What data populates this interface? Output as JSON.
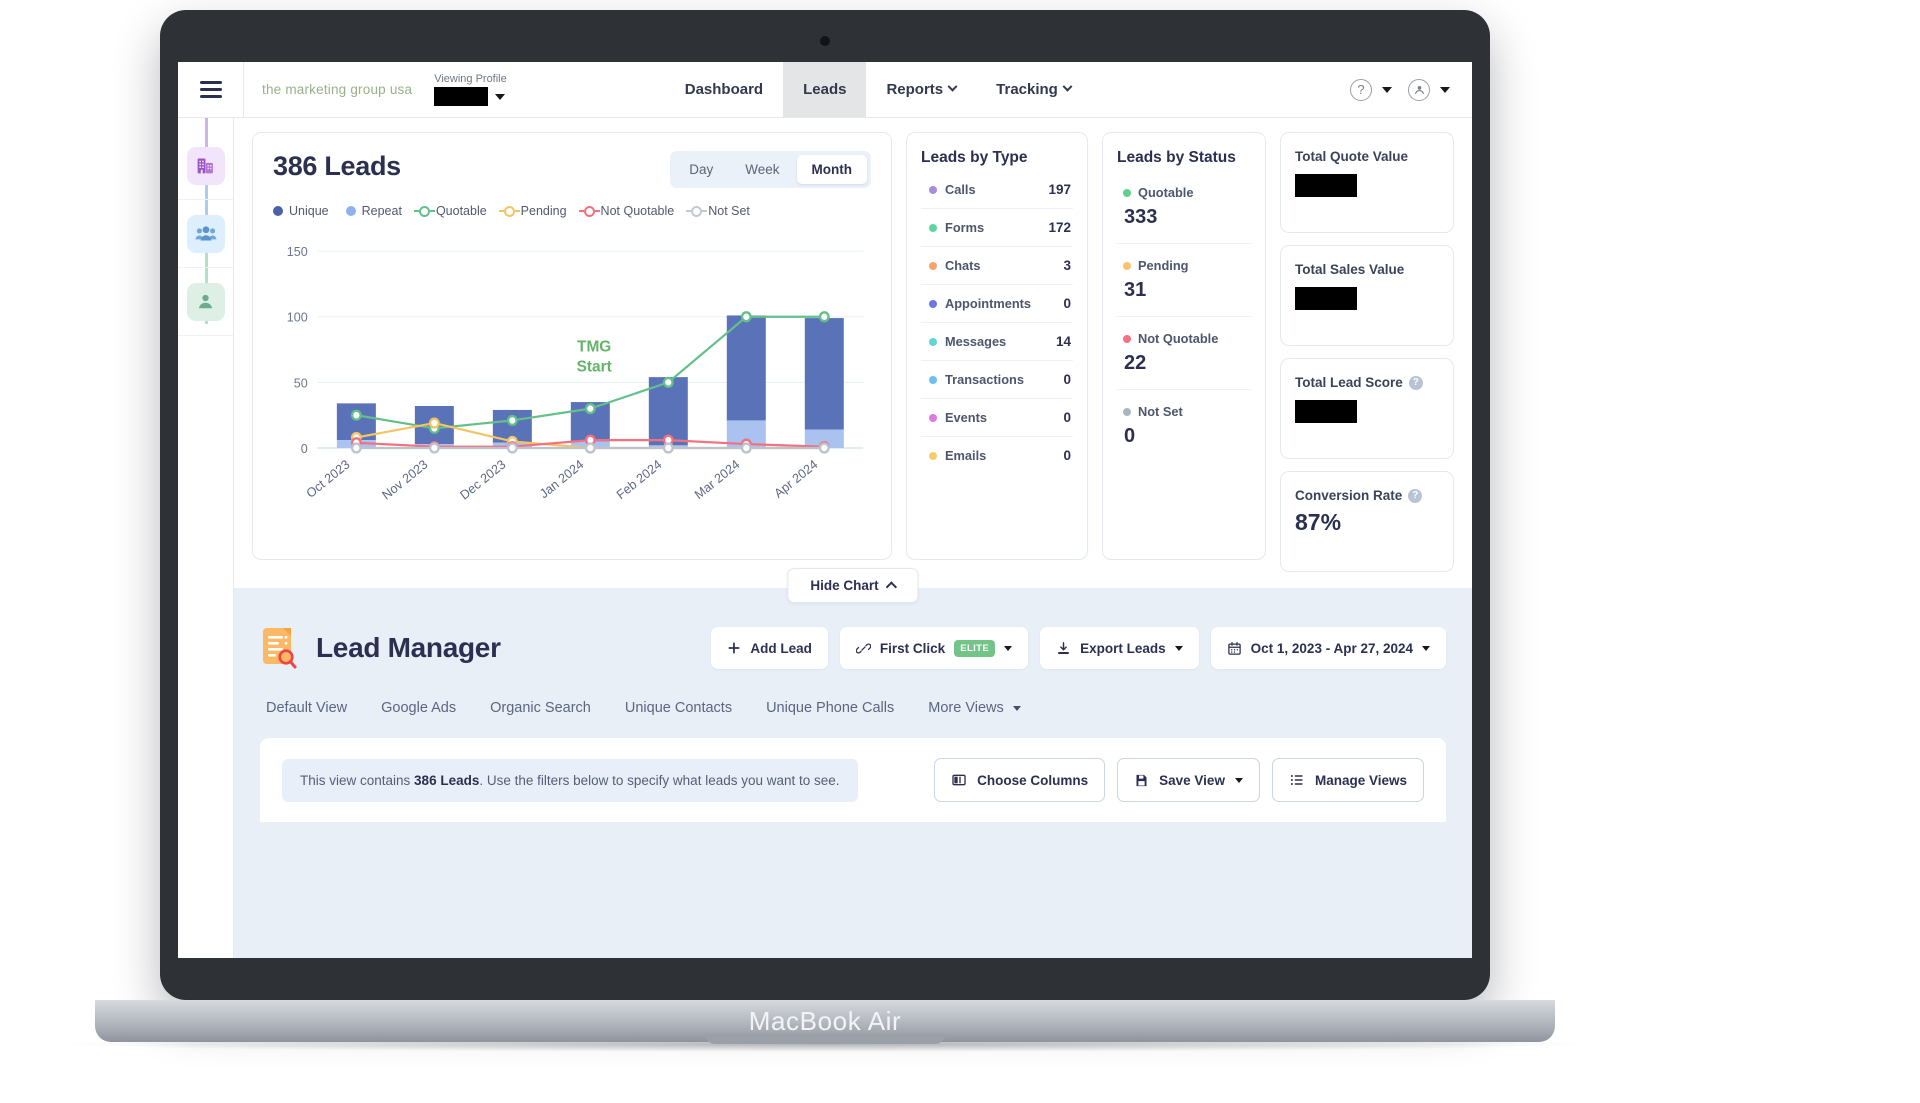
{
  "device": {
    "label": "MacBook Air"
  },
  "topbar": {
    "menu_icon": "hamburger-menu-icon",
    "brand": "the marketing group usa",
    "viewing_profile_label": "Viewing Profile",
    "viewing_profile_value": "",
    "nav": [
      {
        "label": "Dashboard",
        "active": false,
        "caret": false
      },
      {
        "label": "Leads",
        "active": true,
        "caret": false
      },
      {
        "label": "Reports",
        "active": false,
        "caret": true
      },
      {
        "label": "Tracking",
        "active": false,
        "caret": true
      }
    ],
    "help_icon": "question-mark-icon",
    "account_icon": "user-account-icon"
  },
  "rail": {
    "items": [
      {
        "icon": "building-icon",
        "name": "company"
      },
      {
        "icon": "group-people-icon",
        "name": "accounts"
      },
      {
        "icon": "single-person-icon",
        "name": "contact"
      }
    ]
  },
  "chart_panel": {
    "title": "386 Leads",
    "range_toggle": {
      "options": [
        "Day",
        "Week",
        "Month"
      ],
      "selected": "Month"
    }
  },
  "chart_data": {
    "type": "bar",
    "title": "386 Leads",
    "xlabel": "",
    "ylabel": "",
    "ylim": [
      0,
      160
    ],
    "yticks": [
      0,
      50,
      100,
      150
    ],
    "grid": true,
    "legend_position": "top-left",
    "categories": [
      "Oct 2023",
      "Nov 2023",
      "Dec 2023",
      "Jan 2024",
      "Feb 2024",
      "Mar 2024",
      "Apr 2024"
    ],
    "annotation": {
      "text": "TMG Start",
      "line1": "TMG",
      "line2": "Start",
      "color": "#63b36a",
      "at_category": "Jan 2024"
    },
    "series": [
      {
        "name": "Unique",
        "type": "bar-stacked",
        "color": "#5a73b8",
        "values": [
          28,
          29,
          25,
          30,
          52,
          80,
          85
        ]
      },
      {
        "name": "Repeat",
        "type": "bar-stacked",
        "color": "#a9c2ef",
        "values": [
          6,
          3,
          4,
          5,
          2,
          21,
          14
        ]
      },
      {
        "name": "Quotable",
        "type": "line",
        "color": "#63c08a",
        "values": [
          25,
          15,
          21,
          30,
          50,
          100,
          100
        ]
      },
      {
        "name": "Pending",
        "type": "line",
        "color": "#f4c463",
        "values": [
          8,
          19,
          5,
          0,
          0,
          0,
          0
        ]
      },
      {
        "name": "Not Quotable",
        "type": "line",
        "color": "#f2707f",
        "values": [
          4,
          1,
          1,
          6,
          6,
          3,
          1
        ]
      },
      {
        "name": "Not Set",
        "type": "line",
        "color": "#bcc3cf",
        "values": [
          0,
          0,
          0,
          0,
          0,
          0,
          0
        ]
      }
    ]
  },
  "leads_by_type": {
    "title": "Leads by Type",
    "rows": [
      {
        "label": "Calls",
        "value": "197",
        "color": "#a78ce0"
      },
      {
        "label": "Forms",
        "value": "172",
        "color": "#5ed6a4"
      },
      {
        "label": "Chats",
        "value": "3",
        "color": "#f7a46a"
      },
      {
        "label": "Appointments",
        "value": "0",
        "color": "#6a77e8"
      },
      {
        "label": "Messages",
        "value": "14",
        "color": "#62d7cd"
      },
      {
        "label": "Transactions",
        "value": "0",
        "color": "#6fc0f2"
      },
      {
        "label": "Events",
        "value": "0",
        "color": "#e07ae0"
      },
      {
        "label": "Emails",
        "value": "0",
        "color": "#f7cd6a"
      }
    ]
  },
  "leads_by_status": {
    "title": "Leads by Status",
    "rows": [
      {
        "label": "Quotable",
        "value": "333",
        "color": "#5fd28a"
      },
      {
        "label": "Pending",
        "value": "31",
        "color": "#f8c467"
      },
      {
        "label": "Not Quotable",
        "value": "22",
        "color": "#f7707f"
      },
      {
        "label": "Not Set",
        "value": "0",
        "color": "#a9b6bd"
      }
    ]
  },
  "stat_cards": [
    {
      "title": "Total Quote Value",
      "value": "",
      "redacted": true,
      "help": false
    },
    {
      "title": "Total Sales Value",
      "value": "",
      "redacted": true,
      "help": false
    },
    {
      "title": "Total Lead Score",
      "value": "",
      "redacted": true,
      "help": true
    },
    {
      "title": "Conversion Rate",
      "value": "87%",
      "redacted": false,
      "help": true
    }
  ],
  "hide_chart": {
    "label": "Hide Chart",
    "icon": "chevron-up-icon"
  },
  "lead_manager": {
    "icon": "document-search-icon",
    "title": "Lead Manager",
    "actions": [
      {
        "label": "Add Lead",
        "icon": "plus-icon",
        "caret": false,
        "badge": ""
      },
      {
        "label": "First Click",
        "icon": "link-icon",
        "caret": true,
        "badge": "ELITE"
      },
      {
        "label": "Export Leads",
        "icon": "download-icon",
        "caret": true,
        "badge": ""
      },
      {
        "label": "Oct 1, 2023 - Apr 27, 2024",
        "icon": "calendar-icon",
        "caret": true,
        "badge": ""
      }
    ],
    "views": [
      {
        "label": "Default View",
        "caret": false
      },
      {
        "label": "Google Ads",
        "caret": false
      },
      {
        "label": "Organic Search",
        "caret": false
      },
      {
        "label": "Unique Contacts",
        "caret": false
      },
      {
        "label": "Unique Phone Calls",
        "caret": false
      },
      {
        "label": "More Views",
        "caret": true
      }
    ],
    "notice_prefix": "This view contains ",
    "notice_bold": "386 Leads",
    "notice_suffix": ". Use the filters below to specify what leads you want to see.",
    "panel_buttons": [
      {
        "label": "Choose Columns",
        "icon": "columns-icon",
        "caret": false
      },
      {
        "label": "Save View",
        "icon": "save-disk-icon",
        "caret": true
      },
      {
        "label": "Manage Views",
        "icon": "list-icon",
        "caret": false
      }
    ]
  }
}
